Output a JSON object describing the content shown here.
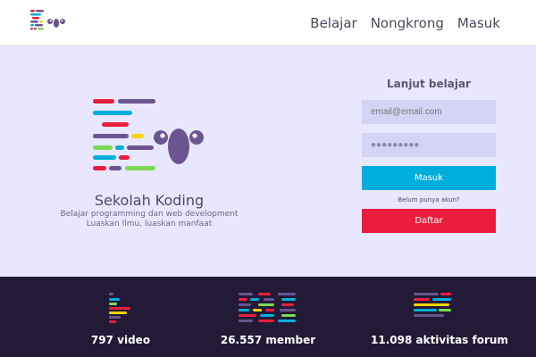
{
  "nav": {
    "items": [
      "Belajar",
      "Nongkrong",
      "Masuk"
    ]
  },
  "brand": {
    "name": "Sekolah Koding",
    "tagline_1": "Belajar programming dan web development",
    "tagline_2": "Luaskan Ilmu, luaskan manfaat"
  },
  "login_form": {
    "title": "Lanjut belajar",
    "email_placeholder": "email@email.com",
    "password_value": "●●●●●●●●●",
    "login_button": "Masuk",
    "no_account_text": "Belum punya akun?",
    "register_button": "Daftar"
  },
  "stats": [
    {
      "label": "797  video",
      "icon": "video-icon"
    },
    {
      "label": "26.557 member",
      "icon": "member-icon"
    },
    {
      "label": "11.098 aktivitas forum",
      "icon": "forum-icon"
    }
  ],
  "colors": {
    "hero_bg": "#e8e7fd",
    "stats_bg": "#231a36",
    "login_button": "#00aedb",
    "register_button": "#ea1e3c",
    "brand_purple": "#6a5590"
  }
}
